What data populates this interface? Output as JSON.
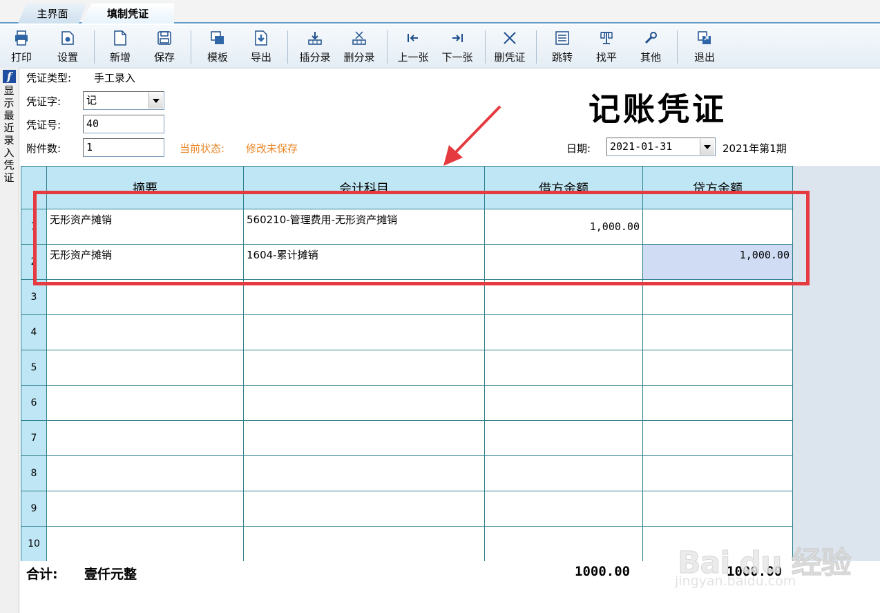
{
  "tabs": [
    {
      "label": "主界面"
    },
    {
      "label": "填制凭证",
      "active": true
    }
  ],
  "toolbar": {
    "print": "打印",
    "settings": "设置",
    "new": "新增",
    "save": "保存",
    "template": "模板",
    "export": "导出",
    "insert_entry": "插分录",
    "delete_entry": "删分录",
    "prev": "上一张",
    "next": "下一张",
    "delete_voucher": "删凭证",
    "jump": "跳转",
    "balance": "找平",
    "other": "其他",
    "exit": "退出"
  },
  "sidebar": {
    "icon": "f-logo-icon",
    "label": "显示最近录入凭证"
  },
  "header": {
    "type_label": "凭证类型:",
    "type_value": "手工录入",
    "word_label": "凭证字:",
    "word_value": "记",
    "number_label": "凭证号:",
    "number_value": "40",
    "attach_label": "附件数:",
    "attach_value": "1",
    "status_label": "当前状态:",
    "status_value": "修改未保存",
    "title": "记账凭证",
    "date_label": "日期:",
    "date_value": "2021-01-31",
    "period": "2021年第1期"
  },
  "grid": {
    "columns": [
      "摘要",
      "会计科目",
      "借方金额",
      "贷方金额"
    ],
    "rows": [
      {
        "no": "1",
        "summary": "无形资产摊销",
        "account": "560210-管理费用-无形资产摊销",
        "debit": "1,000.00",
        "credit": ""
      },
      {
        "no": "2",
        "summary": "无形资产摊销",
        "account": "1604-累计摊销",
        "debit": "",
        "credit": "1,000.00"
      },
      {
        "no": "3",
        "summary": "",
        "account": "",
        "debit": "",
        "credit": ""
      },
      {
        "no": "4",
        "summary": "",
        "account": "",
        "debit": "",
        "credit": ""
      },
      {
        "no": "5",
        "summary": "",
        "account": "",
        "debit": "",
        "credit": ""
      },
      {
        "no": "6",
        "summary": "",
        "account": "",
        "debit": "",
        "credit": ""
      },
      {
        "no": "7",
        "summary": "",
        "account": "",
        "debit": "",
        "credit": ""
      },
      {
        "no": "8",
        "summary": "",
        "account": "",
        "debit": "",
        "credit": ""
      },
      {
        "no": "9",
        "summary": "",
        "account": "",
        "debit": "",
        "credit": ""
      },
      {
        "no": "10",
        "summary": "",
        "account": "",
        "debit": "",
        "credit": ""
      }
    ]
  },
  "totals": {
    "label": "合计:",
    "words": "壹仟元整",
    "debit": "1000.00",
    "credit": "1000.00"
  },
  "watermark": {
    "logo": "Bai du 经验",
    "url": "jingyan.baidu.com"
  },
  "colors": {
    "status_orange": "#e8872a",
    "annotation_red": "#e53a3f",
    "header_cell": "#bfe6f4",
    "grid_line": "#2c7f8a",
    "selected_cell": "#cfdcf4"
  }
}
